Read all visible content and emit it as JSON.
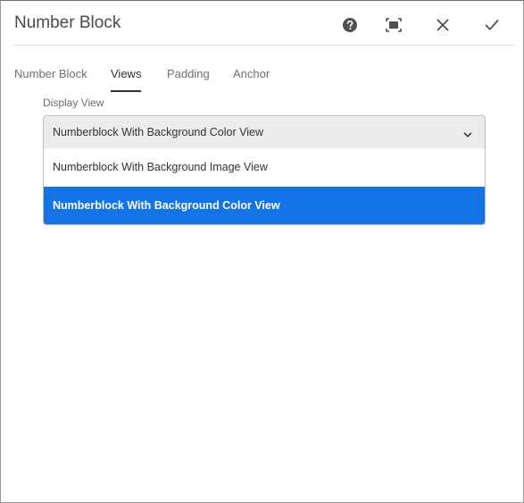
{
  "dialog": {
    "title": "Number Block",
    "icons": [
      "help-icon",
      "fullscreen-icon",
      "close-icon",
      "checkmark-icon"
    ]
  },
  "tabs": [
    {
      "label": "Number Block",
      "active": false
    },
    {
      "label": "Views",
      "active": true
    },
    {
      "label": "Padding",
      "active": false
    },
    {
      "label": "Anchor",
      "active": false
    }
  ],
  "display_view": {
    "label": "Display View",
    "selected": "Numberblock With Background Color View",
    "options": [
      {
        "label": "Numberblock With Background Image View",
        "selected": false
      },
      {
        "label": "Numberblock With Background Color View",
        "selected": true
      }
    ]
  },
  "colors": {
    "accent": "#1473e6",
    "text": "#323232",
    "muted": "#6e6e6e",
    "field_bg": "#ececec"
  }
}
